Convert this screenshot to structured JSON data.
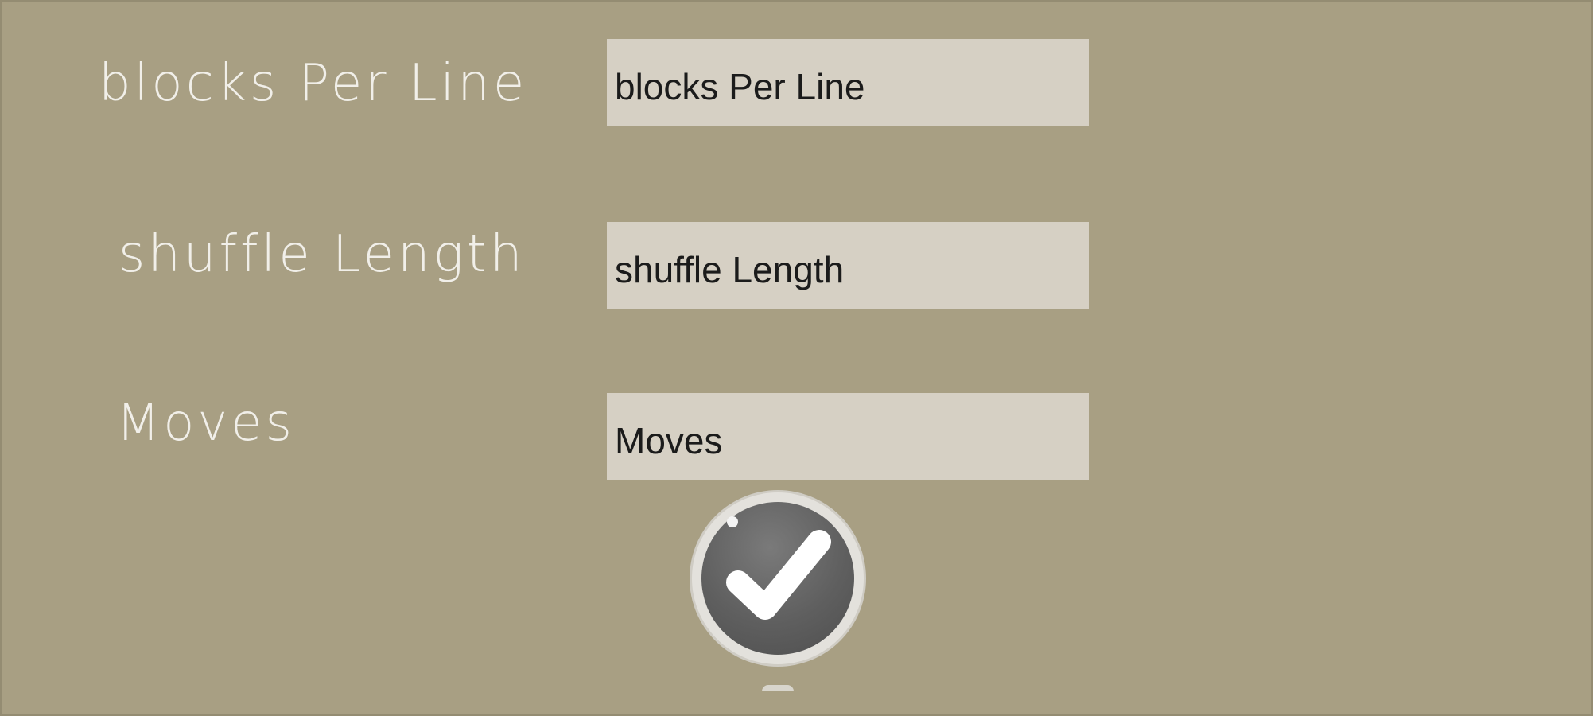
{
  "form": {
    "fields": [
      {
        "label": "blocks Per Line",
        "placeholder": "blocks Per Line",
        "value": ""
      },
      {
        "label": "shuffle Length",
        "placeholder": "shuffle Length",
        "value": ""
      },
      {
        "label": "Moves",
        "placeholder": "Moves",
        "value": ""
      }
    ]
  },
  "confirm_button": {
    "icon": "checkmark-icon"
  },
  "colors": {
    "background": "#a89f83",
    "input_background": "#d6d0c4",
    "label_text": "#f1efe9",
    "input_text": "#1b1b1b",
    "button_ring": "#e3e1dc",
    "button_fill": "#5f5f5f",
    "checkmark": "#ffffff"
  }
}
